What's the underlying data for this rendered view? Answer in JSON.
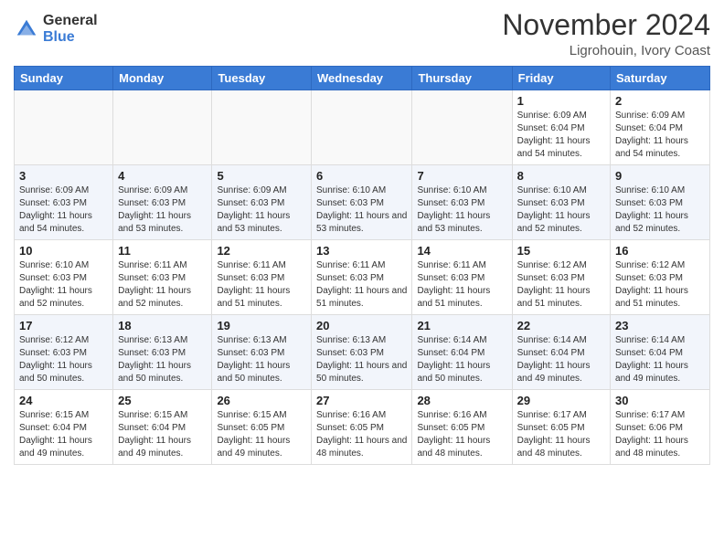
{
  "header": {
    "logo_general": "General",
    "logo_blue": "Blue",
    "month_title": "November 2024",
    "location": "Ligrohouin, Ivory Coast"
  },
  "weekdays": [
    "Sunday",
    "Monday",
    "Tuesday",
    "Wednesday",
    "Thursday",
    "Friday",
    "Saturday"
  ],
  "weeks": [
    [
      {
        "day": "",
        "info": ""
      },
      {
        "day": "",
        "info": ""
      },
      {
        "day": "",
        "info": ""
      },
      {
        "day": "",
        "info": ""
      },
      {
        "day": "",
        "info": ""
      },
      {
        "day": "1",
        "info": "Sunrise: 6:09 AM\nSunset: 6:04 PM\nDaylight: 11 hours\nand 54 minutes."
      },
      {
        "day": "2",
        "info": "Sunrise: 6:09 AM\nSunset: 6:04 PM\nDaylight: 11 hours\nand 54 minutes."
      }
    ],
    [
      {
        "day": "3",
        "info": "Sunrise: 6:09 AM\nSunset: 6:03 PM\nDaylight: 11 hours\nand 54 minutes."
      },
      {
        "day": "4",
        "info": "Sunrise: 6:09 AM\nSunset: 6:03 PM\nDaylight: 11 hours\nand 53 minutes."
      },
      {
        "day": "5",
        "info": "Sunrise: 6:09 AM\nSunset: 6:03 PM\nDaylight: 11 hours\nand 53 minutes."
      },
      {
        "day": "6",
        "info": "Sunrise: 6:10 AM\nSunset: 6:03 PM\nDaylight: 11 hours\nand 53 minutes."
      },
      {
        "day": "7",
        "info": "Sunrise: 6:10 AM\nSunset: 6:03 PM\nDaylight: 11 hours\nand 53 minutes."
      },
      {
        "day": "8",
        "info": "Sunrise: 6:10 AM\nSunset: 6:03 PM\nDaylight: 11 hours\nand 52 minutes."
      },
      {
        "day": "9",
        "info": "Sunrise: 6:10 AM\nSunset: 6:03 PM\nDaylight: 11 hours\nand 52 minutes."
      }
    ],
    [
      {
        "day": "10",
        "info": "Sunrise: 6:10 AM\nSunset: 6:03 PM\nDaylight: 11 hours\nand 52 minutes."
      },
      {
        "day": "11",
        "info": "Sunrise: 6:11 AM\nSunset: 6:03 PM\nDaylight: 11 hours\nand 52 minutes."
      },
      {
        "day": "12",
        "info": "Sunrise: 6:11 AM\nSunset: 6:03 PM\nDaylight: 11 hours\nand 51 minutes."
      },
      {
        "day": "13",
        "info": "Sunrise: 6:11 AM\nSunset: 6:03 PM\nDaylight: 11 hours\nand 51 minutes."
      },
      {
        "day": "14",
        "info": "Sunrise: 6:11 AM\nSunset: 6:03 PM\nDaylight: 11 hours\nand 51 minutes."
      },
      {
        "day": "15",
        "info": "Sunrise: 6:12 AM\nSunset: 6:03 PM\nDaylight: 11 hours\nand 51 minutes."
      },
      {
        "day": "16",
        "info": "Sunrise: 6:12 AM\nSunset: 6:03 PM\nDaylight: 11 hours\nand 51 minutes."
      }
    ],
    [
      {
        "day": "17",
        "info": "Sunrise: 6:12 AM\nSunset: 6:03 PM\nDaylight: 11 hours\nand 50 minutes."
      },
      {
        "day": "18",
        "info": "Sunrise: 6:13 AM\nSunset: 6:03 PM\nDaylight: 11 hours\nand 50 minutes."
      },
      {
        "day": "19",
        "info": "Sunrise: 6:13 AM\nSunset: 6:03 PM\nDaylight: 11 hours\nand 50 minutes."
      },
      {
        "day": "20",
        "info": "Sunrise: 6:13 AM\nSunset: 6:03 PM\nDaylight: 11 hours\nand 50 minutes."
      },
      {
        "day": "21",
        "info": "Sunrise: 6:14 AM\nSunset: 6:04 PM\nDaylight: 11 hours\nand 50 minutes."
      },
      {
        "day": "22",
        "info": "Sunrise: 6:14 AM\nSunset: 6:04 PM\nDaylight: 11 hours\nand 49 minutes."
      },
      {
        "day": "23",
        "info": "Sunrise: 6:14 AM\nSunset: 6:04 PM\nDaylight: 11 hours\nand 49 minutes."
      }
    ],
    [
      {
        "day": "24",
        "info": "Sunrise: 6:15 AM\nSunset: 6:04 PM\nDaylight: 11 hours\nand 49 minutes."
      },
      {
        "day": "25",
        "info": "Sunrise: 6:15 AM\nSunset: 6:04 PM\nDaylight: 11 hours\nand 49 minutes."
      },
      {
        "day": "26",
        "info": "Sunrise: 6:15 AM\nSunset: 6:05 PM\nDaylight: 11 hours\nand 49 minutes."
      },
      {
        "day": "27",
        "info": "Sunrise: 6:16 AM\nSunset: 6:05 PM\nDaylight: 11 hours\nand 48 minutes."
      },
      {
        "day": "28",
        "info": "Sunrise: 6:16 AM\nSunset: 6:05 PM\nDaylight: 11 hours\nand 48 minutes."
      },
      {
        "day": "29",
        "info": "Sunrise: 6:17 AM\nSunset: 6:05 PM\nDaylight: 11 hours\nand 48 minutes."
      },
      {
        "day": "30",
        "info": "Sunrise: 6:17 AM\nSunset: 6:06 PM\nDaylight: 11 hours\nand 48 minutes."
      }
    ]
  ]
}
